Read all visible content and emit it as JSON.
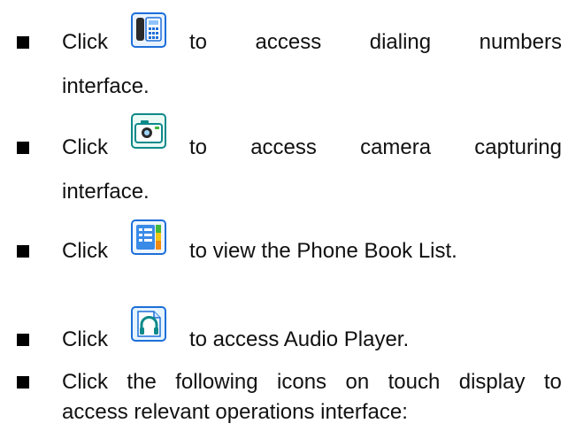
{
  "items": [
    {
      "click": "Click",
      "icon": "phone-dial-icon",
      "line1_words": [
        "to",
        "access",
        "dialing",
        "numbers"
      ],
      "line2": "interface."
    },
    {
      "click": "Click",
      "icon": "camera-icon",
      "line1_words": [
        "to",
        "access",
        "camera",
        "capturing"
      ],
      "line2": "interface."
    },
    {
      "click": "Click",
      "icon": "phone-book-icon",
      "text": "to view the Phone Book List."
    },
    {
      "click": "Click",
      "icon": "audio-player-icon",
      "text": "to access Audio Player."
    },
    {
      "line1_words": [
        "Click",
        "the",
        "following",
        "icons",
        "on",
        "touch",
        "display",
        "to"
      ],
      "line2": "access relevant operations interface:"
    }
  ],
  "colors": {
    "text": "#111111",
    "bullet": "#000000",
    "icon_blue": "#1d6fd8",
    "icon_teal": "#0f8a8a",
    "icon_green": "#42b83a",
    "icon_orange": "#f08a12"
  }
}
